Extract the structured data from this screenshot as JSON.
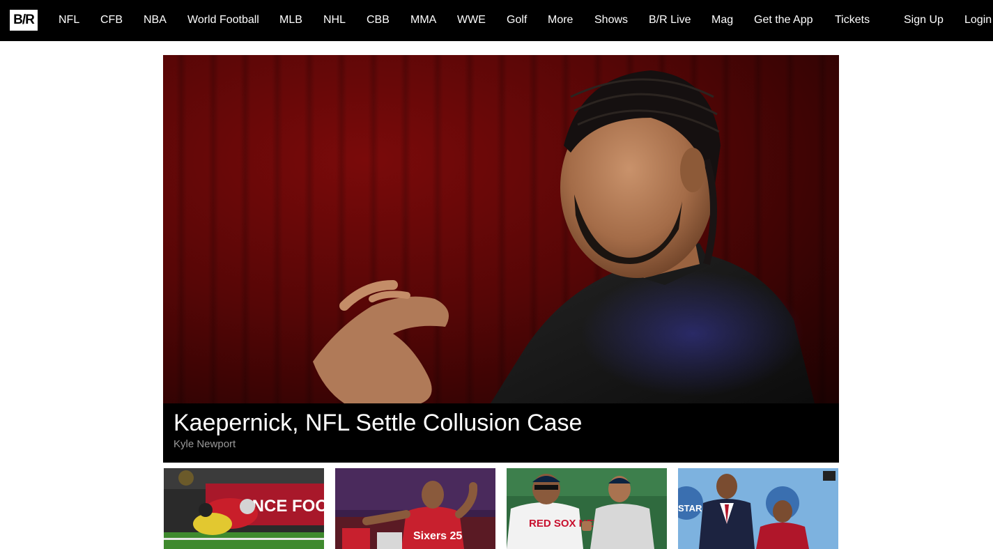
{
  "nav": {
    "logo": "B/R",
    "items": [
      "NFL",
      "CFB",
      "NBA",
      "World Football",
      "MLB",
      "NHL",
      "CBB",
      "MMA",
      "WWE",
      "Golf",
      "More",
      "Shows",
      "B/R Live",
      "Mag",
      "Get the App",
      "Tickets"
    ],
    "sign_up": "Sign Up",
    "login": "Login"
  },
  "hero": {
    "title": "Kaepernick, NFL Settle Collusion Case",
    "author": "Kyle Newport"
  },
  "thumbnails": [
    {
      "image": "football-tackle-photo",
      "visible_text": "LIANCE FOOTBALL"
    },
    {
      "image": "basketball-player-photo",
      "visible_text": "Sixers 25"
    },
    {
      "image": "baseball-players-photo",
      "visible_text": "RED SOX NEW YORK"
    },
    {
      "image": "basketball-allstar-photo",
      "visible_text": "STAR Sprin"
    }
  ],
  "colors": {
    "nav_bg": "#000000",
    "nav_text": "#ffffff",
    "caption_bg": "#000000",
    "author_text": "#9a9a9a"
  }
}
